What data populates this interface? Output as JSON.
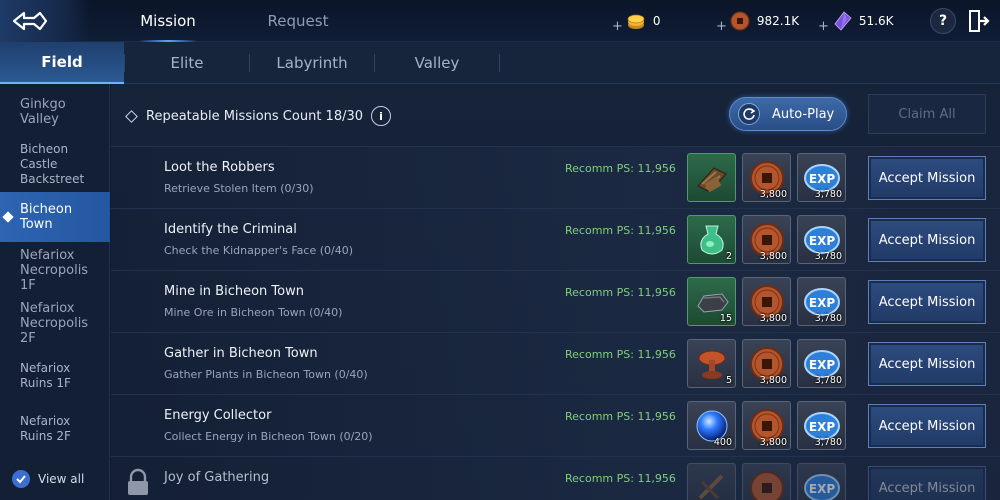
{
  "top": {
    "tabs": [
      {
        "label": "Mission",
        "active": true
      },
      {
        "label": "Request",
        "active": false
      }
    ],
    "currencies": [
      {
        "icon": "gold-coin-icon",
        "plus": "+",
        "value": "0"
      },
      {
        "icon": "copper-coin-icon",
        "plus": "+",
        "value": "982.1K"
      },
      {
        "icon": "purple-crystal-icon",
        "plus": "+",
        "value": "51.6K"
      }
    ],
    "help_label": "?",
    "exit_icon": "exit-door-icon"
  },
  "subtabs": [
    {
      "label": "Field",
      "active": true
    },
    {
      "label": "Elite",
      "active": false
    },
    {
      "label": "Labyrinth",
      "active": false
    },
    {
      "label": "Valley",
      "active": false
    }
  ],
  "nav": {
    "items": [
      {
        "label": "Ginkgo Valley",
        "active": false
      },
      {
        "label": "Bicheon Castle Backstreet",
        "active": false
      },
      {
        "label": "Bicheon Town",
        "active": true
      },
      {
        "label": "Nefariox Necropolis 1F",
        "active": false
      },
      {
        "label": "Nefariox Necropolis 2F",
        "active": false
      },
      {
        "label": "Nefariox Ruins 1F",
        "active": false
      },
      {
        "label": "Nefariox Ruins 2F",
        "active": false
      }
    ],
    "view_all_label": "View all",
    "view_all_checked": true
  },
  "header": {
    "count_label": "Repeatable Missions Count 18/30",
    "info_label": "i",
    "autoplay_label": "Auto-Play",
    "claim_all_label": "Claim All"
  },
  "missions": [
    {
      "title": "Loot the Robbers",
      "subtitle": "Retrieve Stolen Item (0/30)",
      "recomm": "Recomm PS: 11,956",
      "item_icon": "stolen-goods-icon",
      "item_qty": "",
      "coin_qty": "3,800",
      "exp_qty": "3,780",
      "accept_label": "Accept Mission"
    },
    {
      "title": "Identify the Criminal",
      "subtitle": "Check the Kidnapper's Face (0/40)",
      "recomm": "Recomm PS: 11,956",
      "item_icon": "green-potion-icon",
      "item_qty": "2",
      "coin_qty": "3,800",
      "exp_qty": "3,780",
      "accept_label": "Accept Mission"
    },
    {
      "title": "Mine in Bicheon Town",
      "subtitle": "Mine Ore in Bicheon Town (0/40)",
      "recomm": "Recomm PS: 11,956",
      "item_icon": "iron-ore-icon",
      "item_qty": "15",
      "coin_qty": "3,800",
      "exp_qty": "3,780",
      "accept_label": "Accept Mission"
    },
    {
      "title": "Gather in Bicheon Town",
      "subtitle": "Gather Plants in Bicheon Town (0/40)",
      "recomm": "Recomm PS: 11,956",
      "item_icon": "mushroom-icon",
      "item_qty": "5",
      "coin_qty": "3,800",
      "exp_qty": "3,780",
      "accept_label": "Accept Mission"
    },
    {
      "title": "Energy Collector",
      "subtitle": "Collect Energy in Bicheon Town (0/20)",
      "recomm": "Recomm PS: 11,956",
      "item_icon": "energy-orb-icon",
      "item_qty": "400",
      "coin_qty": "3,800",
      "exp_qty": "3,780",
      "accept_label": "Accept Mission"
    },
    {
      "title": "Joy of Gathering",
      "subtitle": "",
      "recomm": "Recomm PS: 11,956",
      "item_icon": "wooden-item-icon",
      "item_qty": "",
      "coin_qty": "",
      "exp_qty": "",
      "accept_label": "Accept Mission",
      "locked": true
    }
  ],
  "reward_labels": {
    "exp_text": "EXP"
  },
  "colors": {
    "accent": "#2e64b2",
    "recomm_green": "#7fcf7c",
    "background": "#0e1b30"
  }
}
